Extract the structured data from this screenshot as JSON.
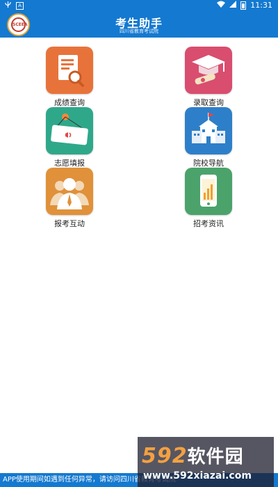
{
  "status_bar": {
    "left_icons": [
      "usb-icon",
      "a-box-icon"
    ],
    "time": "11:31"
  },
  "header": {
    "title": "考生助手",
    "subtitle": "四川省教育考试院",
    "logo_text": "SCEEA",
    "color": "#1479d0"
  },
  "tiles": [
    {
      "label": "成绩查询",
      "icon": "score-search-icon",
      "color": "#e8733a"
    },
    {
      "label": "录取查询",
      "icon": "admission-cap-icon",
      "color": "#d94d6f"
    },
    {
      "label": "志愿填报",
      "icon": "sign-board-icon",
      "color": "#2fa88a"
    },
    {
      "label": "院校导航",
      "icon": "school-building-icon",
      "color": "#2e7fc9"
    },
    {
      "label": "报考互动",
      "icon": "people-icon",
      "color": "#e0913a"
    },
    {
      "label": "招考资讯",
      "icon": "phone-chart-icon",
      "color": "#4ba36b"
    }
  ],
  "footer": {
    "text": "APP使用期间如遇到任何异常，请访问四川省教育考试院"
  },
  "watermark": {
    "brand_num": "592",
    "brand_text": "软件园",
    "url": "www.592xiazai.com"
  }
}
